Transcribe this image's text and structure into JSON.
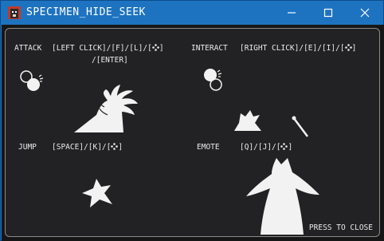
{
  "window": {
    "title": "SPECIMEN_HIDE_SEEK",
    "controls": {
      "minimize": "minimize",
      "maximize": "maximize",
      "close": "close"
    }
  },
  "controls": [
    {
      "action": "ATTACK",
      "keys_line1": "[LEFT CLICK]/[F]/[L]/[",
      "keys_line1_end": "]",
      "keys_line2": "/[ENTER]"
    },
    {
      "action": "INTERACT",
      "keys_line1": "[RIGHT CLICK]/[E]/[I]/[",
      "keys_line1_end": "]"
    },
    {
      "action": "JUMP",
      "keys_line1": "[SPACE]/[K]/[",
      "keys_line1_end": "]"
    },
    {
      "action": "EMOTE",
      "keys_line1": "[Q]/[J]/[",
      "keys_line1_end": "]"
    }
  ],
  "footer": {
    "close_hint": "PRESS TO CLOSE"
  },
  "colors": {
    "titlebar": "#1e73c0",
    "panel": "#222224",
    "text": "#eaeaea",
    "silhouette": "#f2f2f2"
  },
  "icons": {
    "gamepad": "gamepad-buttons-icon",
    "mouse_left": "mouse-left-click-icon",
    "mouse_right": "mouse-right-click-icon"
  }
}
